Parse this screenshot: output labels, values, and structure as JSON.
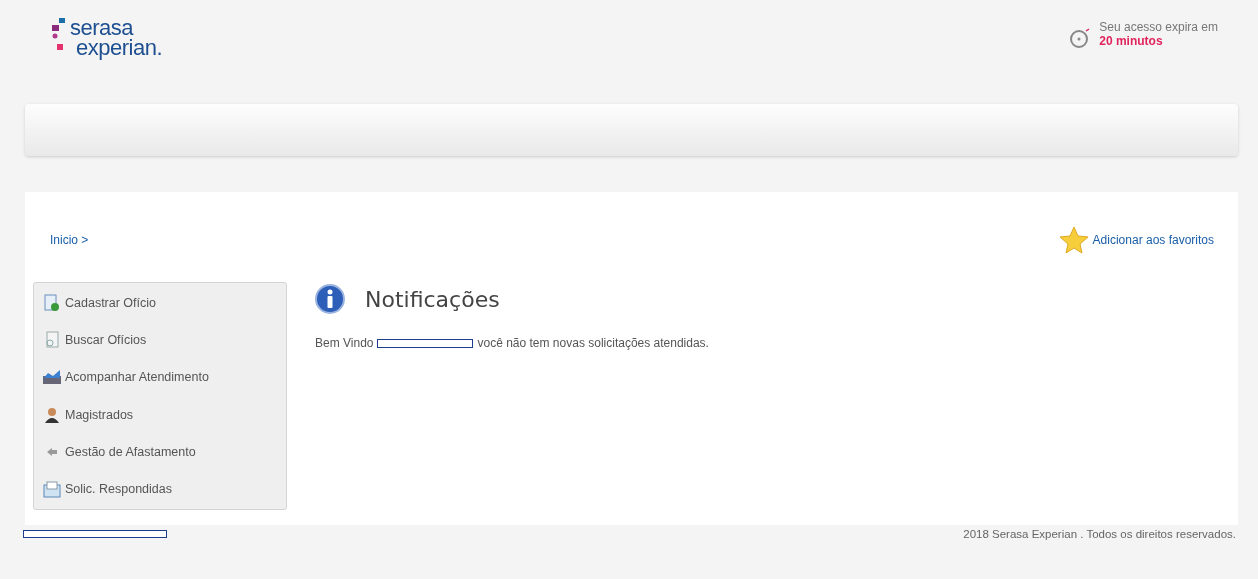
{
  "logo": {
    "line_1": "serasa",
    "line_2": "experian."
  },
  "session": {
    "label": "Seu acesso expira em",
    "time": "20 minutos"
  },
  "breadcrumb": "Inicio >",
  "favorites": "Adicionar aos favoritos",
  "menu": [
    {
      "label": "Cadastrar Ofício"
    },
    {
      "label": "Buscar Ofícios"
    },
    {
      "label": "Acompanhar Atendimento"
    },
    {
      "label": "Magistrados"
    },
    {
      "label": "Gestão de Afastamento"
    },
    {
      "label": "Solic. Respondidas"
    }
  ],
  "notifications": {
    "title": "Notificações",
    "greeting": "Bem Vindo",
    "message": "você não tem novas solicitações atendidas."
  },
  "footer": "2018 Serasa Experian . Todos os direitos reservados."
}
